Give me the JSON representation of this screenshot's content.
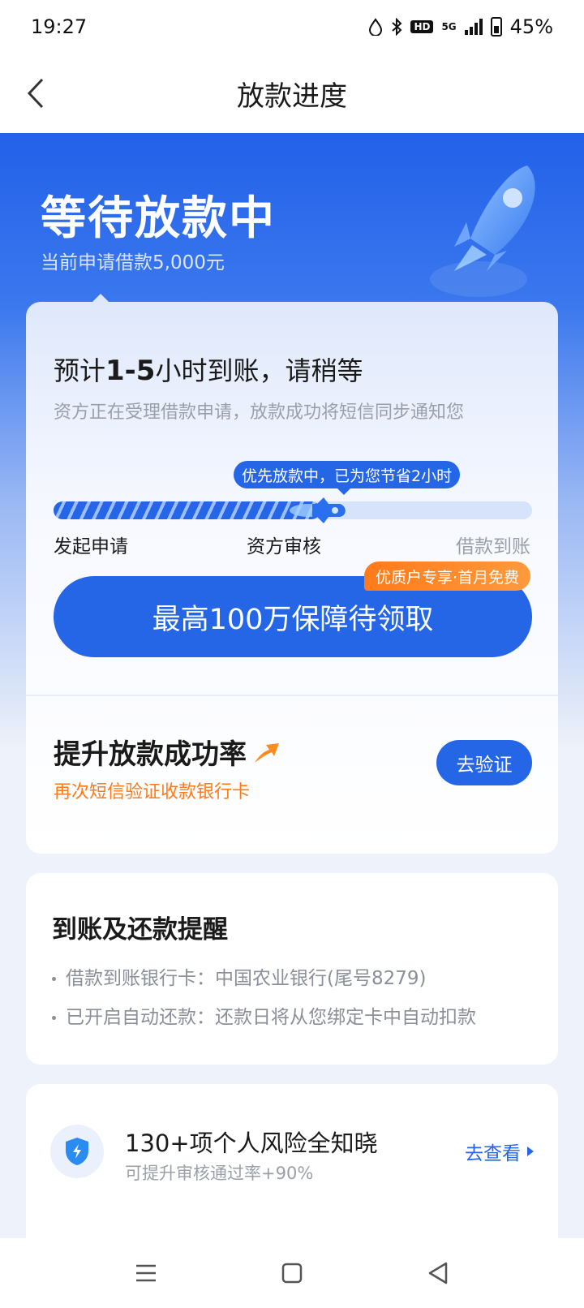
{
  "status_bar": {
    "time": "19:27",
    "battery": "45%",
    "network": "5G",
    "hd": "HD"
  },
  "nav": {
    "title": "放款进度"
  },
  "hero": {
    "title": "等待放款中",
    "subtitle": "当前申请借款5,000元"
  },
  "progress": {
    "eta_prefix": "预计",
    "eta_range": "1-5",
    "eta_suffix": "小时到账，请稍等",
    "description": "资方正在受理借款申请，放款成功将短信同步通知您",
    "priority_note": "优先放款中，已为您节省2小时",
    "fill_fraction": 0.66,
    "steps": [
      "发起申请",
      "资方审核",
      "借款到账"
    ]
  },
  "promo": {
    "tag": "优质户专享·首月免费",
    "button_label": "最高100万保障待领取"
  },
  "boost": {
    "title": "提升放款成功率",
    "subtitle": "再次短信验证收款银行卡",
    "button_label": "去验证"
  },
  "reminder": {
    "title": "到账及还款提醒",
    "items": [
      "借款到账银行卡：中国农业银行(尾号8279)",
      "已开启自动还款：还款日将从您绑定卡中自动扣款"
    ]
  },
  "risk": {
    "title": "130+项个人风险全知晓",
    "subtitle": "可提升审核通过率+90%",
    "link_label": "去查看"
  },
  "colors": {
    "brand": "#2466e6",
    "accent": "#ff7a1a"
  }
}
